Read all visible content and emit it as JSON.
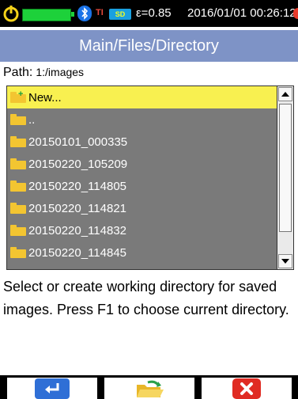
{
  "status_bar": {
    "emissivity": "ε=0.85",
    "datetime": "2016/01/01 00:26:12",
    "ti_label": "TI",
    "sd_label": "SD",
    "battery_color": "#1dd13a"
  },
  "title": "Main/Files/Directory",
  "path": {
    "label": "Path:",
    "value": "1:/images"
  },
  "files": [
    {
      "label": "New...",
      "icon": "new-folder-icon",
      "selected": true
    },
    {
      "label": "..",
      "icon": "folder-icon",
      "selected": false
    },
    {
      "label": "20150101_000335",
      "icon": "folder-icon",
      "selected": false
    },
    {
      "label": "20150220_105209",
      "icon": "folder-icon",
      "selected": false
    },
    {
      "label": "20150220_114805",
      "icon": "folder-icon",
      "selected": false
    },
    {
      "label": "20150220_114821",
      "icon": "folder-icon",
      "selected": false
    },
    {
      "label": "20150220_114832",
      "icon": "folder-icon",
      "selected": false
    },
    {
      "label": "20150220_114845",
      "icon": "folder-icon",
      "selected": false
    }
  ],
  "description": "Select or create working directory for saved images. Press F1 to choose current directory.",
  "softkeys": [
    {
      "name": "enter-icon"
    },
    {
      "name": "open-folder-icon"
    },
    {
      "name": "close-icon"
    }
  ],
  "colors": {
    "title_bg": "#7e93c6",
    "list_bg": "#7a7a7a",
    "selected_bg": "#f8f050"
  }
}
